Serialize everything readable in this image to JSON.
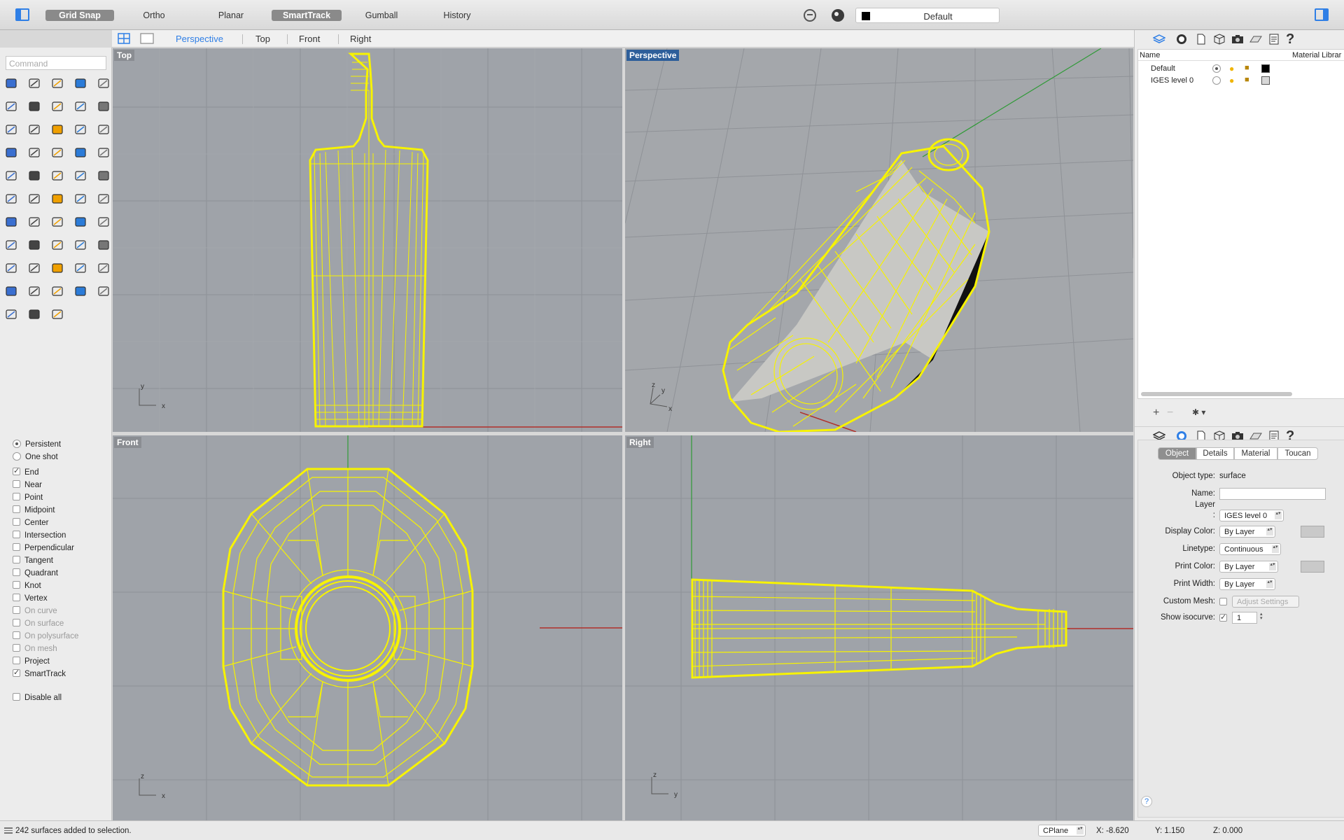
{
  "toolbar": {
    "grid_snap": "Grid Snap",
    "ortho": "Ortho",
    "planar": "Planar",
    "smarttrack": "SmartTrack",
    "gumball": "Gumball",
    "history": "History",
    "current_layer": "Default"
  },
  "viewtabs": [
    "Perspective",
    "Top",
    "Front",
    "Right"
  ],
  "command_placeholder": "Command",
  "viewports": {
    "top": "Top",
    "perspective": "Perspective",
    "front": "Front",
    "right": "Right"
  },
  "axis": {
    "x": "x",
    "y": "y",
    "z": "z"
  },
  "osnap": {
    "persistent": "Persistent",
    "one_shot": "One shot",
    "items": [
      {
        "label": "End",
        "checked": true,
        "enabled": true
      },
      {
        "label": "Near",
        "checked": false,
        "enabled": true
      },
      {
        "label": "Point",
        "checked": false,
        "enabled": true
      },
      {
        "label": "Midpoint",
        "checked": false,
        "enabled": true
      },
      {
        "label": "Center",
        "checked": false,
        "enabled": true
      },
      {
        "label": "Intersection",
        "checked": false,
        "enabled": true
      },
      {
        "label": "Perpendicular",
        "checked": false,
        "enabled": true
      },
      {
        "label": "Tangent",
        "checked": false,
        "enabled": true
      },
      {
        "label": "Quadrant",
        "checked": false,
        "enabled": true
      },
      {
        "label": "Knot",
        "checked": false,
        "enabled": true
      },
      {
        "label": "Vertex",
        "checked": false,
        "enabled": true
      },
      {
        "label": "On curve",
        "checked": false,
        "enabled": false
      },
      {
        "label": "On surface",
        "checked": false,
        "enabled": false
      },
      {
        "label": "On polysurface",
        "checked": false,
        "enabled": false
      },
      {
        "label": "On mesh",
        "checked": false,
        "enabled": false
      },
      {
        "label": "Project",
        "checked": false,
        "enabled": true
      },
      {
        "label": "SmartTrack",
        "checked": true,
        "enabled": true
      }
    ],
    "disable_all": "Disable all"
  },
  "layers": {
    "col_name": "Name",
    "col_material": "Material Librar",
    "rows": [
      {
        "name": "Default",
        "current": true,
        "color": "#000000"
      },
      {
        "name": "IGES level 0",
        "current": false,
        "color": "#d8d8d8"
      }
    ],
    "add": "+",
    "remove": "−"
  },
  "properties": {
    "tabs": [
      "Object",
      "Details",
      "Material",
      "Toucan"
    ],
    "object_type_label": "Object type:",
    "object_type": "surface",
    "name_label": "Name:",
    "name_value": "",
    "layer_label_1": "Layer",
    "layer_label_2": ":",
    "layer_value": "IGES level 0",
    "display_color_label": "Display Color:",
    "display_color": "By Layer",
    "linetype_label": "Linetype:",
    "linetype": "Continuous",
    "print_color_label": "Print Color:",
    "print_color": "By Layer",
    "print_width_label": "Print Width:",
    "print_width": "By Layer",
    "custom_mesh_label": "Custom Mesh:",
    "adjust_settings": "Adjust Settings",
    "show_isocurve_label": "Show isocurve:",
    "isocurve_density": "1",
    "help": "?"
  },
  "status": {
    "message": "242 surfaces added to selection.",
    "cplane": "CPlane",
    "x": "X: -8.620",
    "y": "Y: 1.150",
    "z": "Z: 0.000"
  },
  "colors": {
    "wire": "#f7f300",
    "accent": "#2f7fe6",
    "viewport_bg": "#9fa3a9",
    "x_axis": "#b0302a",
    "y_axis": "#2f9a37"
  }
}
